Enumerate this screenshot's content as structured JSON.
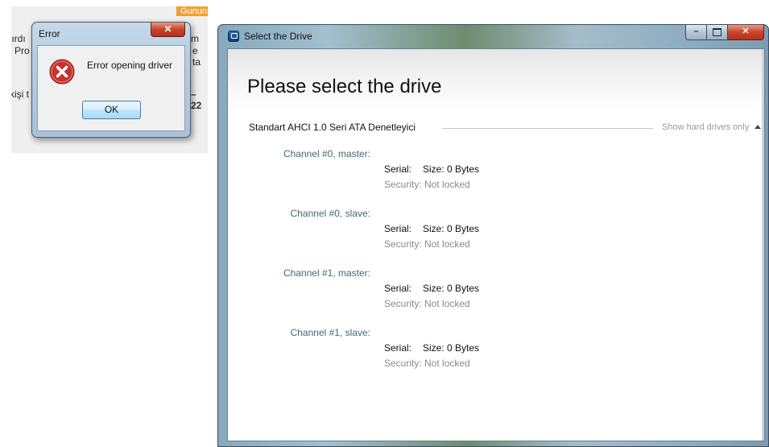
{
  "background_fragment": {
    "orange_tag": "Gunun",
    "line1_left": "tırdı",
    "line1_right": "m",
    "line2_left": "Pro",
    "line2_right": "e ta",
    "line3_left": "kişi t",
    "line3_right": "– 22"
  },
  "error_dialog": {
    "title": "Error",
    "close_glyph": "✕",
    "message": "Error opening driver",
    "ok_label": "OK"
  },
  "drive_window": {
    "title": "Select the Drive",
    "minimize_glyph": "–",
    "close_glyph": "✕",
    "heading": "Please select the drive",
    "controller": "Standart AHCI 1.0 Seri ATA Denetleyici",
    "show_hard_drives": "Show hard drives only",
    "channels": [
      {
        "label": "Channel #0, master:",
        "serial": "Serial:",
        "size": "Size: 0 Bytes",
        "security": "Security: Not locked"
      },
      {
        "label": "Channel #0, slave:",
        "serial": "Serial:",
        "size": "Size: 0 Bytes",
        "security": "Security: Not locked"
      },
      {
        "label": "Channel #1, master:",
        "serial": "Serial:",
        "size": "Size: 0 Bytes",
        "security": "Security: Not locked"
      },
      {
        "label": "Channel #1, slave:",
        "serial": "Serial:",
        "size": "Size: 0 Bytes",
        "security": "Security: Not locked"
      }
    ]
  },
  "colors": {
    "error_icon": "#c8322e",
    "channel_label": "#3d6a73",
    "close_button": "#c8442c"
  }
}
